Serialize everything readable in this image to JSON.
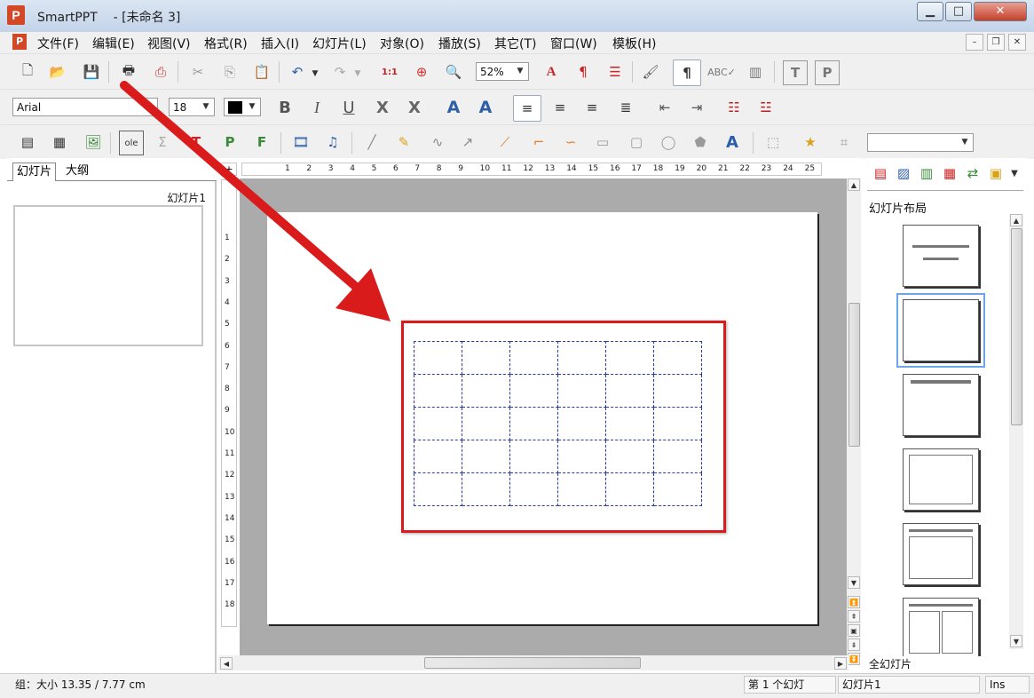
{
  "window": {
    "app_name": "SmartPPT",
    "doc_title": "- [未命名 3]",
    "minimize": "▁",
    "maximize": "□",
    "close": "✕"
  },
  "menu": [
    {
      "label": "文件(F)"
    },
    {
      "label": "编辑(E)"
    },
    {
      "label": "视图(V)"
    },
    {
      "label": "格式(R)"
    },
    {
      "label": "插入(I)"
    },
    {
      "label": "幻灯片(L)"
    },
    {
      "label": "对象(O)"
    },
    {
      "label": "播放(S)"
    },
    {
      "label": "其它(T)"
    },
    {
      "label": "窗口(W)"
    },
    {
      "label": "模板(H)"
    }
  ],
  "toolbar1": {
    "zoom": "52%"
  },
  "toolbar2": {
    "font_name": "Arial",
    "font_size": "18"
  },
  "left_panel": {
    "tabs": [
      "幻灯片",
      "大纲"
    ],
    "slide_label": "幻灯片1"
  },
  "ruler": {
    "h_numbers": [
      "1",
      "2",
      "3",
      "4",
      "5",
      "6",
      "7",
      "8",
      "9",
      "10",
      "11",
      "12",
      "13",
      "14",
      "15",
      "16",
      "17",
      "18",
      "19",
      "20",
      "21",
      "22",
      "23",
      "24",
      "25"
    ],
    "v_numbers": [
      "1",
      "2",
      "3",
      "4",
      "5",
      "6",
      "7",
      "8",
      "9",
      "10",
      "11",
      "12",
      "13",
      "14",
      "15",
      "16",
      "17",
      "18"
    ]
  },
  "table": {
    "rows": 5,
    "cols": 6
  },
  "right_panel": {
    "title": "幻灯片布局",
    "footer": "全幻灯片"
  },
  "status": {
    "object_size": "组：大小 13.35 / 7.77 cm",
    "page": "第 1 个幻灯",
    "slide_name": "幻灯片1",
    "mode": "Ins"
  },
  "colors": {
    "highlight_red": "#d91b1b",
    "grid_blue": "#2a3aa8",
    "selection_blue": "#6aa6e8"
  }
}
